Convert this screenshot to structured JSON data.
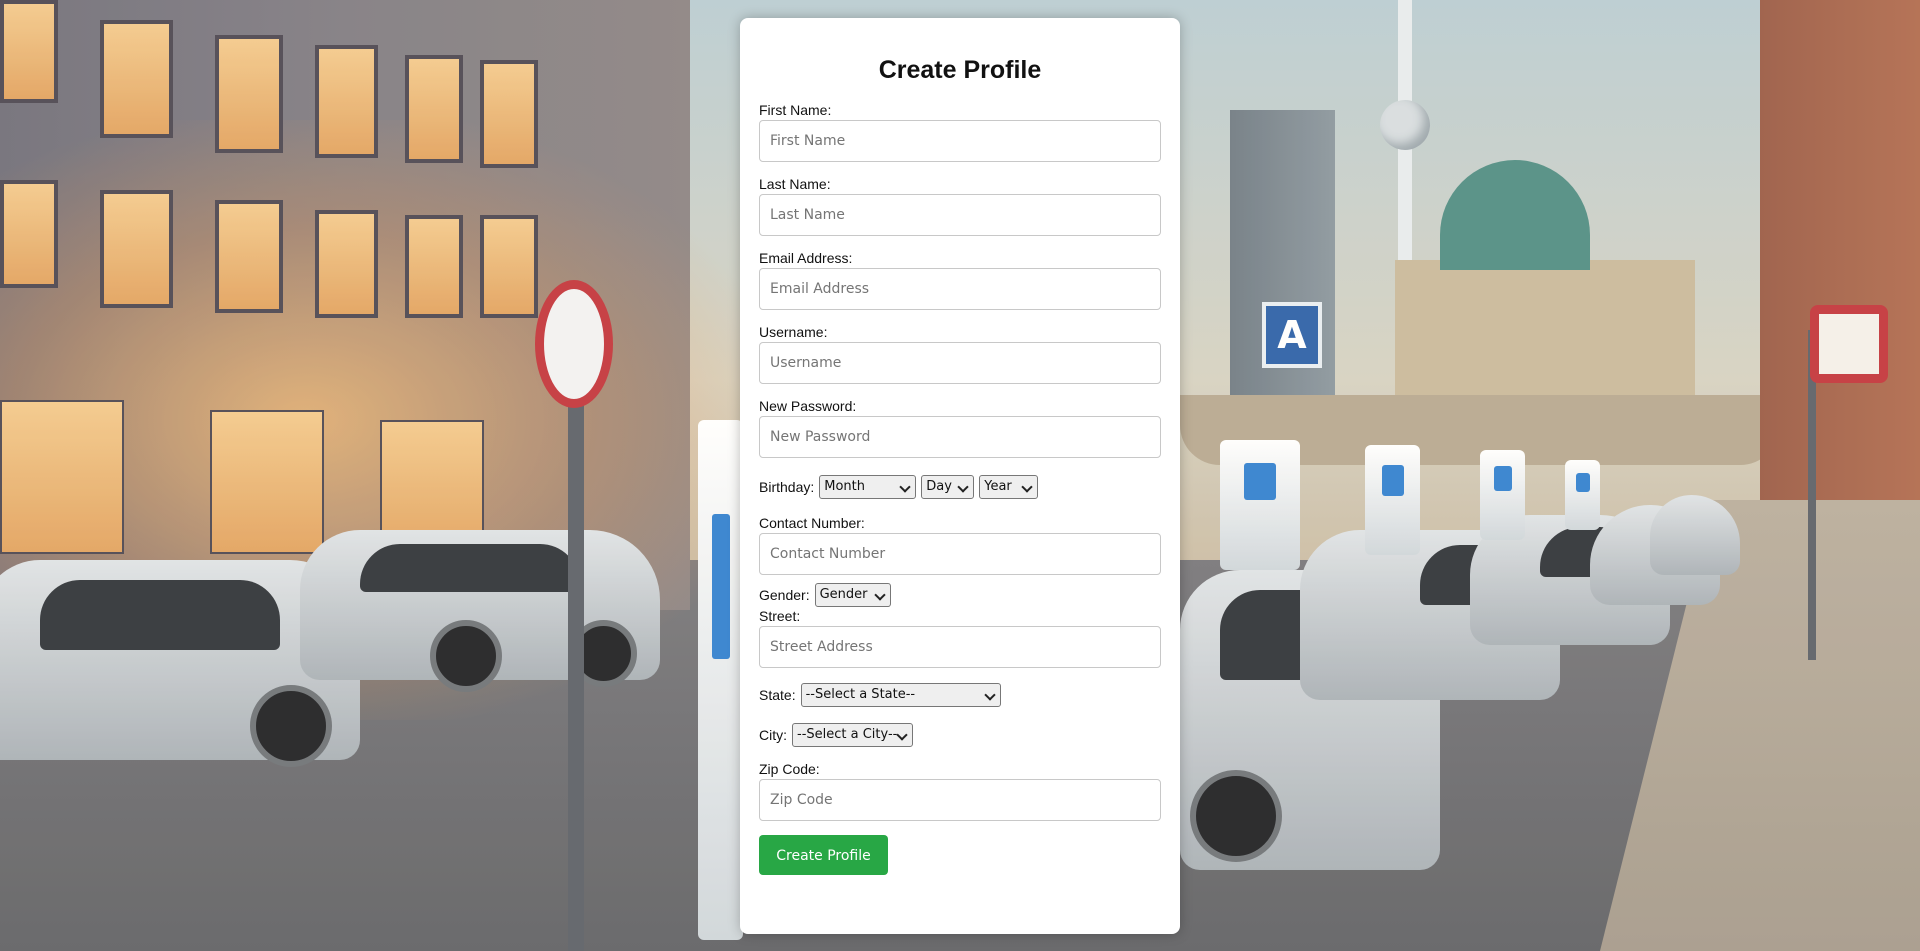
{
  "form": {
    "title": "Create Profile",
    "first_name": {
      "label": "First Name:",
      "placeholder": "First Name"
    },
    "last_name": {
      "label": "Last Name:",
      "placeholder": "Last Name"
    },
    "email": {
      "label": "Email Address:",
      "placeholder": "Email Address"
    },
    "username": {
      "label": "Username:",
      "placeholder": "Username"
    },
    "password": {
      "label": "New Password:",
      "placeholder": "New Password"
    },
    "birthday": {
      "label": "Birthday:",
      "month": "Month",
      "day": "Day",
      "year": "Year"
    },
    "contact": {
      "label": "Contact Number:",
      "placeholder": "Contact Number"
    },
    "gender": {
      "label": "Gender:",
      "selected": "Gender"
    },
    "street": {
      "label": "Street:",
      "placeholder": "Street Address"
    },
    "state": {
      "label": "State:",
      "selected": "--Select a State--"
    },
    "city": {
      "label": "City:",
      "selected": "--Select a City--"
    },
    "zip": {
      "label": "Zip Code:",
      "placeholder": "Zip Code"
    },
    "submit_label": "Create Profile"
  },
  "colors": {
    "submit_button": "#28a745",
    "card_background": "#ffffff"
  },
  "background": {
    "description_icon": "city-street-charging-scene"
  }
}
